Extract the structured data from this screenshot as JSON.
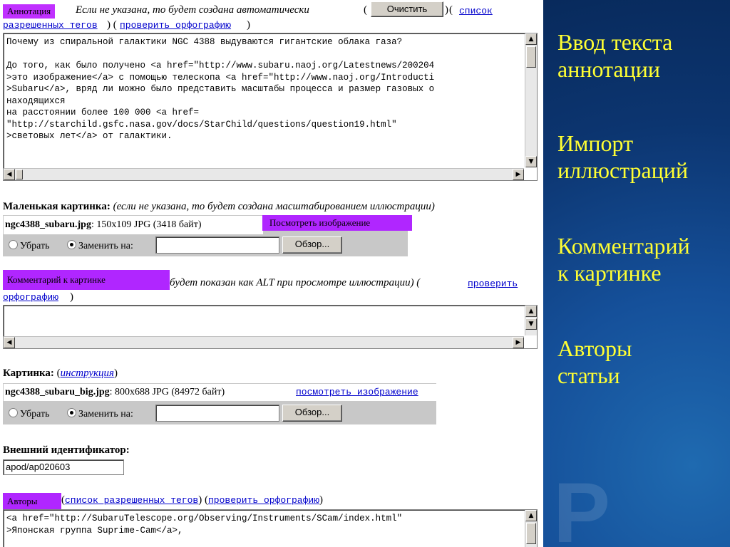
{
  "annotation": {
    "tag": "Аннотация",
    "hint": "Если не указана, то будет создана автоматически",
    "paren_open": "(",
    "clear_button": "Очистить",
    "paren_close": ")",
    "tags_link": "список разрешенных тегов",
    "spell_link": "проверить орфографию",
    "text_lines": [
      "Почему из спиральной галактики NGC 4388 выдуваются гигантские облака газа?",
      "",
      "До того, как было получено <a href=\"http://www.subaru.naoj.org/Latestnews/200204",
      ">это изображение</a> с помощью телескопа <a href=\"http://www.naoj.org/Introducti",
      ">Subaru</a>, вряд ли можно было представить масштабы процесса и размер газовых о",
      "находящихся",
      "на расстоянии более 100 000 <a href=",
      "\"http://starchild.gsfc.nasa.gov/docs/StarChild/questions/question19.html\"",
      ">световых лет</a> от галактики."
    ]
  },
  "small_image": {
    "label": "Маленькая картинка:",
    "hint": "(если не указана, то будет создана масштабированием иллюстрации)",
    "filename": "ngc4388_subaru.jpg",
    "info": ": 150x109 JPG  (3418 байт)",
    "view_tag": "Посмотреть изображение",
    "remove_label": "Убрать",
    "replace_label": "Заменить на:",
    "browse_button": "Обзор..."
  },
  "comment": {
    "tag": "Комментарий к картинке",
    "hint": "будет показан как ALT при просмотре иллюстрации) (",
    "spell_link_1": "проверить",
    "spell_link_2": "орфографию",
    "close": ")"
  },
  "image": {
    "label": "Картинка:",
    "instr_open": "(",
    "instr_link": "инструкция",
    "instr_close": ")",
    "filename": "ngc4388_subaru_big.jpg",
    "info": ": 800x688 JPG  (84972 байт)",
    "view_link": "посмотреть изображение",
    "remove_label": "Убрать",
    "replace_label": "Заменить на:",
    "browse_button": "Обзор..."
  },
  "external_id": {
    "label": "Внешний идентификатор:",
    "value": "apod/ap020603"
  },
  "authors": {
    "tag": "Авторы",
    "tags_open": "(",
    "tags_link": "список разрешенных тегов",
    "between": ") (",
    "spell_link": "проверить орфографию",
    "close": ")",
    "text_lines": [
      "<a href=\"http://SubaruTelescope.org/Observing/Instruments/SCam/index.html\"",
      ">Японская группа Suprime-Cam</a>,"
    ]
  },
  "side_notes": {
    "note1": "Ввод текста\nаннотации",
    "note2": "Импорт\nиллюстраций",
    "note3": "Комментарий\nк картинке",
    "note4": "Авторы\nстатьи"
  },
  "colors": {
    "tag_bg": "#a020f0",
    "note_text": "#ffff33",
    "panel_bg": "#0c3570"
  }
}
